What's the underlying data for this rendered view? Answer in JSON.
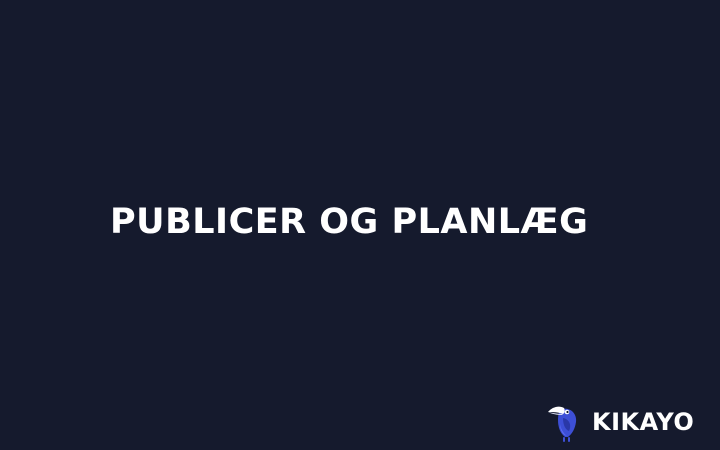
{
  "slide": {
    "headline": "PUBLICER OG PLANLÆG",
    "background_color": "#151a2d",
    "text_color": "#ffffff"
  },
  "brand": {
    "name": "KIKAYO",
    "logo_icon": "toucan-bird-icon",
    "logo_color": "#3d4fd6",
    "beak_color": "#ffffff"
  }
}
